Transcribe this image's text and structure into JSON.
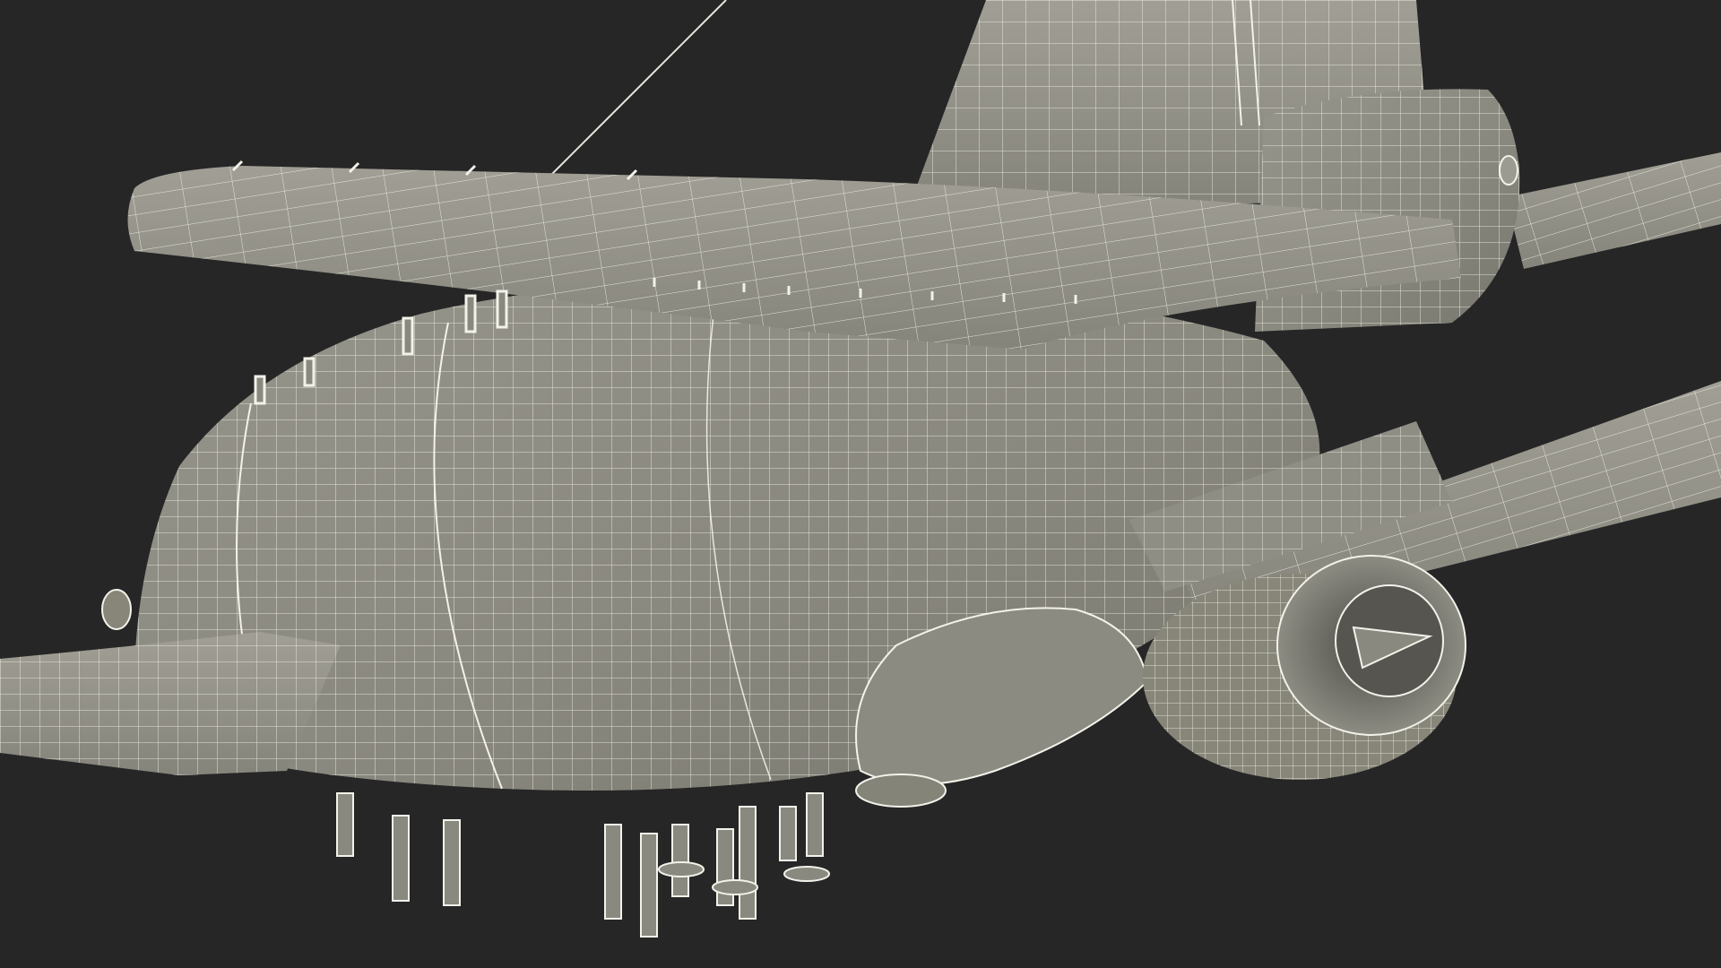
{
  "scene": {
    "subject": "aircraft-wireframe-model",
    "background_color": "#262626",
    "surface_color": "#8f8e84",
    "surface_shadow_color": "#6f6e66",
    "surface_highlight_color": "#a3a298",
    "wire_color": "#f2f2ea"
  }
}
